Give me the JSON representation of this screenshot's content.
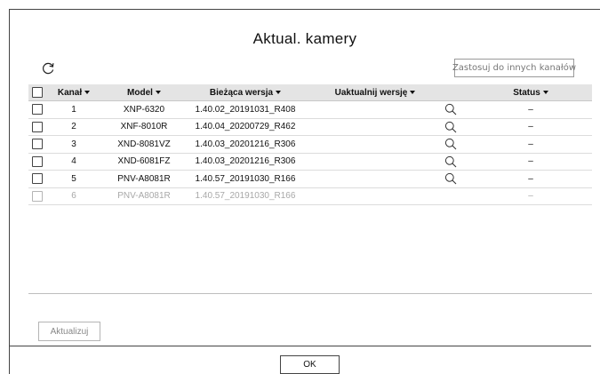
{
  "dialog": {
    "title": "Aktual. kamery",
    "apply_button": "Zastosuj do innych kanałów",
    "update_button": "Aktualizuj",
    "ok_button": "OK"
  },
  "table": {
    "headers": {
      "channel": "Kanał",
      "model": "Model",
      "current_version": "Bieżąca wersja",
      "update_version": "Uaktualnij wersję",
      "status": "Status"
    },
    "rows": [
      {
        "channel": "1",
        "model": "XNP-6320",
        "current_version": "1.40.02_20191031_R408",
        "status": "–",
        "enabled": true
      },
      {
        "channel": "2",
        "model": "XNF-8010R",
        "current_version": "1.40.04_20200729_R462",
        "status": "–",
        "enabled": true
      },
      {
        "channel": "3",
        "model": "XND-8081VZ",
        "current_version": "1.40.03_20201216_R306",
        "status": "–",
        "enabled": true
      },
      {
        "channel": "4",
        "model": "XND-6081FZ",
        "current_version": "1.40.03_20201216_R306",
        "status": "–",
        "enabled": true
      },
      {
        "channel": "5",
        "model": "PNV-A8081R",
        "current_version": "1.40.57_20191030_R166",
        "status": "–",
        "enabled": true
      },
      {
        "channel": "6",
        "model": "PNV-A8081R",
        "current_version": "1.40.57_20191030_R166",
        "status": "–",
        "enabled": false
      }
    ]
  },
  "icons": {
    "refresh": "refresh-icon",
    "search": "search-icon"
  }
}
